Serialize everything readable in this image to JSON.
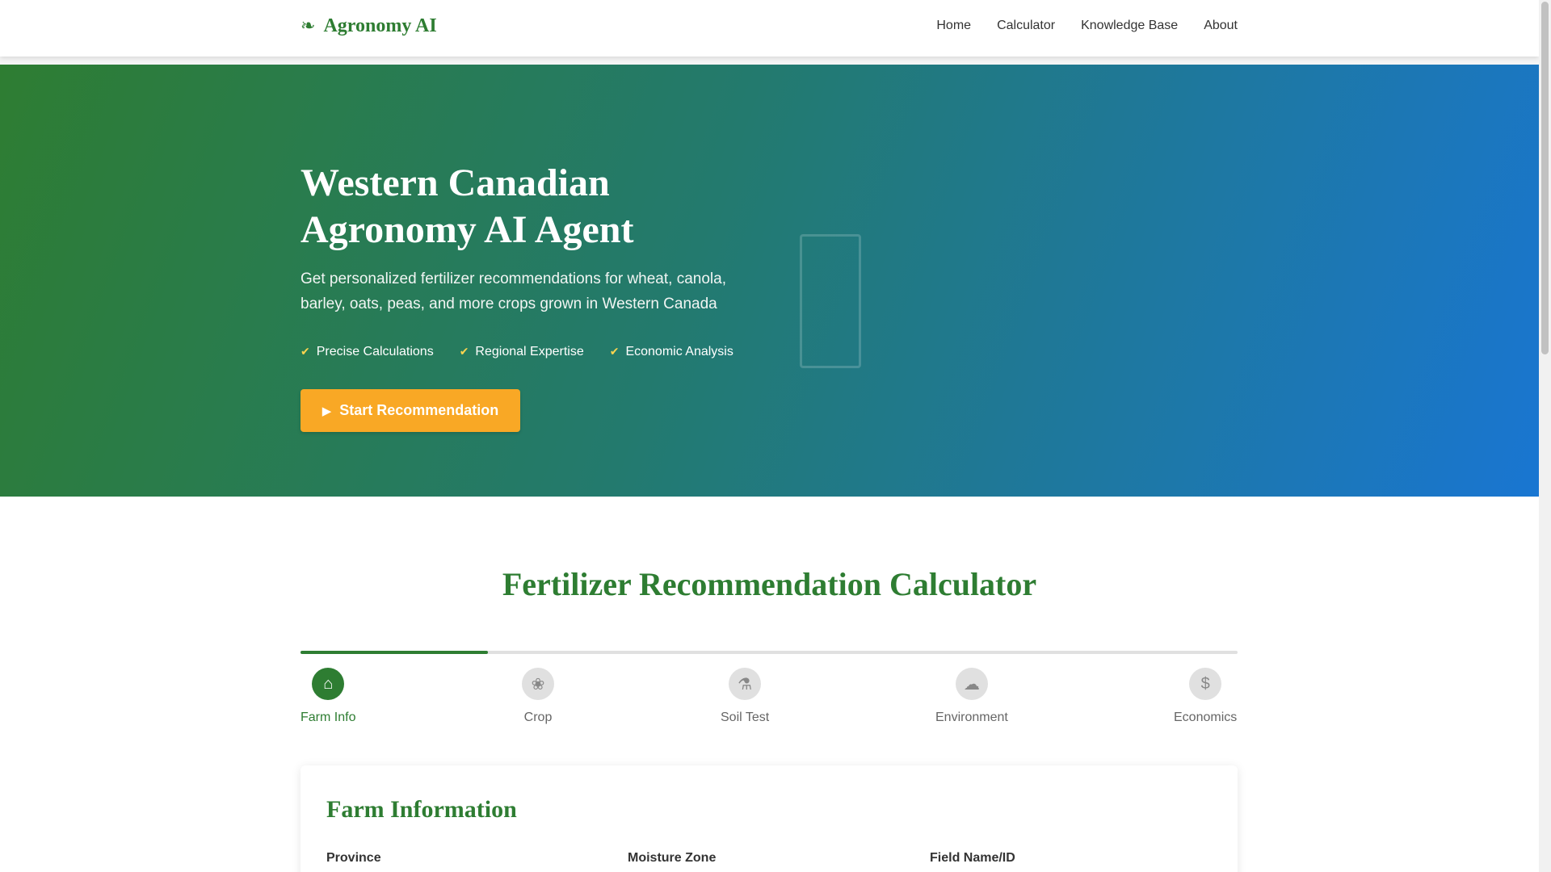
{
  "header": {
    "brand": "Agronomy AI",
    "nav": [
      "Home",
      "Calculator",
      "Knowledge Base",
      "About"
    ]
  },
  "hero": {
    "title": "Western Canadian Agronomy AI Agent",
    "subtitle": "Get personalized fertilizer recommendations for wheat, canola, barley, oats, peas, and more crops grown in Western Canada",
    "features": [
      "Precise Calculations",
      "Regional Expertise",
      "Economic Analysis"
    ],
    "cta_label": "Start Recommendation"
  },
  "calculator": {
    "title": "Fertilizer Recommendation Calculator",
    "progress": 0.2,
    "steps": [
      {
        "label": "Farm Info",
        "icon": "farm-icon",
        "active": true
      },
      {
        "label": "Crop",
        "icon": "crop-icon",
        "active": false
      },
      {
        "label": "Soil Test",
        "icon": "soil-test-icon",
        "active": false
      },
      {
        "label": "Environment",
        "icon": "environment-icon",
        "active": false
      },
      {
        "label": "Economics",
        "icon": "dollar-icon",
        "symbol": "$",
        "active": false
      }
    ],
    "form": {
      "title": "Farm Information",
      "fields": [
        "Province",
        "Moisture Zone",
        "Field Name/ID"
      ]
    }
  },
  "colors": {
    "primary": "#2e7d32",
    "accent": "#f9a825",
    "gradient_end": "#1976d2"
  }
}
